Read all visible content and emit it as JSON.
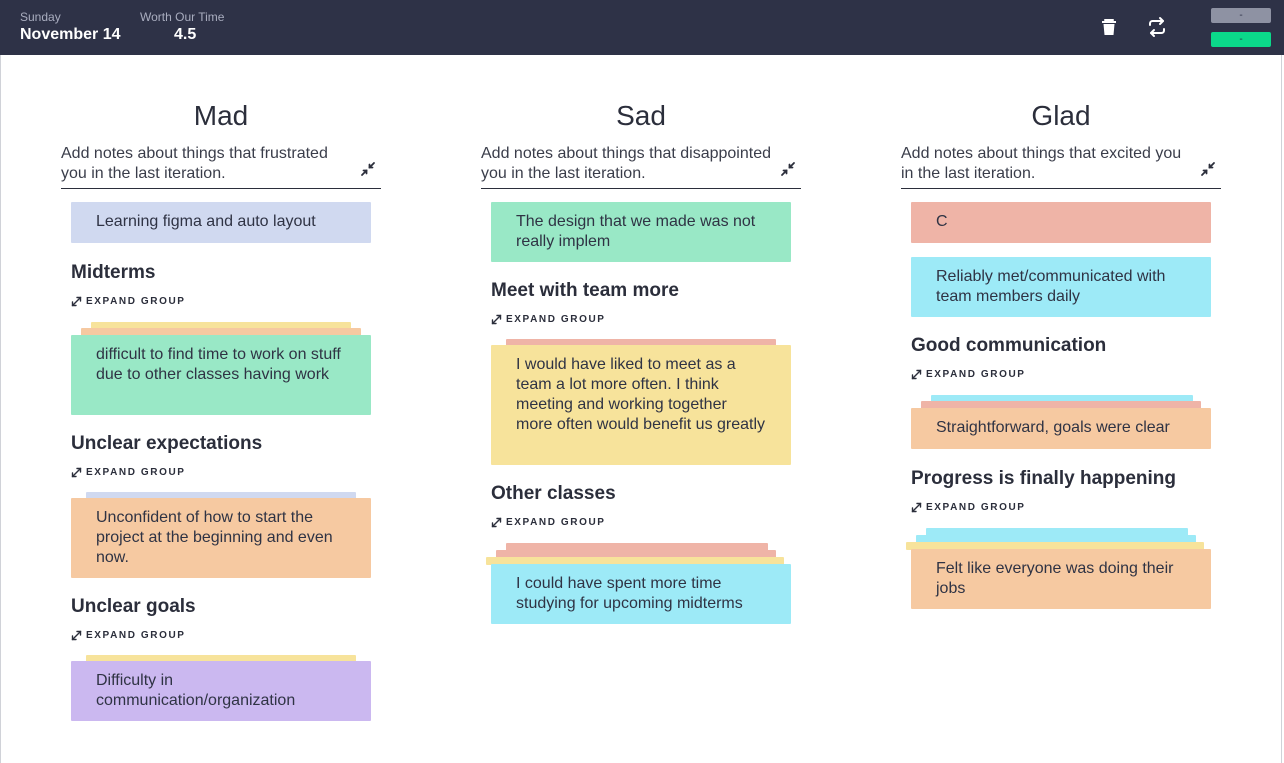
{
  "header": {
    "day_label": "Sunday",
    "date": "November 14",
    "rating_label": "Worth Our Time",
    "rating": "4.5",
    "button_top_label": "-",
    "button_bottom_label": "-",
    "icons": [
      "trash-icon",
      "swap-icon"
    ],
    "colors": {
      "bar": "#2e3247",
      "button_top": "#8e92a3",
      "button_bottom": "#0bd98a"
    }
  },
  "columns": [
    {
      "title": "Mad",
      "prompt": "Add notes about things that frustrated you in the last iteration.",
      "cards": [
        "Learning figma and auto layout"
      ],
      "groups": [
        {
          "title": "Midterms",
          "expand_label": "EXPAND GROUP",
          "card": "difficult to find time to work on stuff due to other classes having work"
        },
        {
          "title": "Unclear expectations",
          "expand_label": "EXPAND GROUP",
          "card": "Unconfident of how to start the project at the beginning and even now."
        },
        {
          "title": "Unclear goals",
          "expand_label": "EXPAND GROUP",
          "card": "Difficulty in communication/organization"
        }
      ]
    },
    {
      "title": "Sad",
      "prompt": "Add notes about things that disappointed you in the last iteration.",
      "cards": [
        "The design that we made was not really implem"
      ],
      "groups": [
        {
          "title": "Meet with team more",
          "expand_label": "EXPAND GROUP",
          "card": "I would have liked to meet as a team a lot more often. I think meeting and working together more often would benefit us greatly"
        },
        {
          "title": "Other classes",
          "expand_label": "EXPAND GROUP",
          "card": "I could have spent more time studying for upcoming midterms"
        }
      ]
    },
    {
      "title": "Glad",
      "prompt": "Add notes about things that excited you in the last iteration.",
      "cards": [
        "C",
        "Reliably met/communicated with team members daily"
      ],
      "groups": [
        {
          "title": "Good communication",
          "expand_label": "EXPAND GROUP",
          "card": "Straightforward, goals were clear"
        },
        {
          "title": "Progress is finally happening",
          "expand_label": "EXPAND GROUP",
          "card": "Felt like everyone was doing their jobs"
        }
      ]
    }
  ]
}
